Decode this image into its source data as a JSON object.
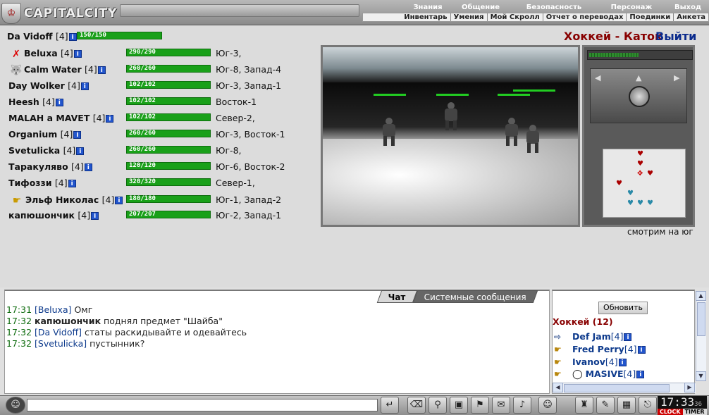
{
  "app": {
    "logo_text": "CAPITALCITY"
  },
  "top_menu": [
    "Знания",
    "Общение",
    "Безопасность",
    "Персонаж",
    "Выход"
  ],
  "sub_menu": [
    "Инвентарь",
    "Умения",
    "Мой Скролл",
    "Отчет о переводах",
    "Поединки",
    "Анкета"
  ],
  "self": {
    "name": "Da Vidoff",
    "level": "[4]",
    "hp_text": "150/150",
    "hp_fraction": 1.0
  },
  "location": {
    "title": "Хоккей - Каток",
    "exit_label": "Выйти",
    "view_caption": "смотрим на юг"
  },
  "players": [
    {
      "name": "Beluxa",
      "level": "[4]",
      "hp": "290/290",
      "pos": "Юг-3,",
      "icon": "red-cross-icon"
    },
    {
      "name": "Calm Water",
      "level": "[4]",
      "hp": "260/260",
      "pos": "Юг-8, Запад-4",
      "icon": "wolf-icon"
    },
    {
      "name": "Day Wolker",
      "level": "[4]",
      "hp": "102/102",
      "pos": "Юг-3, Запад-1",
      "icon": ""
    },
    {
      "name": "Heesh",
      "level": "[4]",
      "hp": "102/102",
      "pos": "Восток-1",
      "icon": ""
    },
    {
      "name": "MALAH a MAVET",
      "level": "[4]",
      "hp": "102/102",
      "pos": "Север-2,",
      "icon": ""
    },
    {
      "name": "Organium",
      "level": "[4]",
      "hp": "260/260",
      "pos": "Юг-3, Восток-1",
      "icon": ""
    },
    {
      "name": "Svetulicka",
      "level": "[4]",
      "hp": "260/260",
      "pos": "Юг-8,",
      "icon": ""
    },
    {
      "name": "Таракуляво",
      "level": "[4]",
      "hp": "120/120",
      "pos": "Юг-6, Восток-2",
      "icon": ""
    },
    {
      "name": "Тифоззи",
      "level": "[4]",
      "hp": "320/320",
      "pos": "Север-1,",
      "icon": ""
    },
    {
      "name": "Эльф Николас",
      "level": "[4]",
      "hp": "180/180",
      "pos": "Юг-1, Запад-2",
      "icon": "golden-hand-icon"
    },
    {
      "name": "капюшончик",
      "level": "[4]",
      "hp": "207/207",
      "pos": "Юг-2, Запад-1",
      "icon": ""
    }
  ],
  "chat": {
    "tabs": [
      "Чат",
      "Системные сообщения"
    ],
    "messages": [
      {
        "time": "17:31",
        "user": "[Beluxa]",
        "text": " Омг"
      },
      {
        "time": "17:32",
        "user": "капюшончик",
        "text": " поднял предмет \"Шайба\""
      },
      {
        "time": "17:32",
        "user": "[Da Vidoff]",
        "text": " статы раскидывайте и одевайтесь"
      },
      {
        "time": "17:32",
        "user": "[Svetulicka]",
        "text": " пустынник?"
      }
    ]
  },
  "room_list": {
    "refresh_label": "Обновить",
    "title": "Хоккей (12)",
    "items": [
      {
        "name": "Def Jam",
        "level": "[4]",
        "icon": "door-arrow-icon"
      },
      {
        "name": "Fred Perry",
        "level": "[4]",
        "icon": "hand-icon"
      },
      {
        "name": "Ivanov",
        "level": "[4]",
        "icon": "hand-icon"
      },
      {
        "name": "MASIVE",
        "level": "[4]",
        "icon": "hand-icon"
      }
    ]
  },
  "bottom": {
    "chat_input_value": "",
    "clock_time": "17:33",
    "clock_seconds": "36",
    "clock_labels": [
      "CLOCK",
      "TIMER"
    ]
  }
}
